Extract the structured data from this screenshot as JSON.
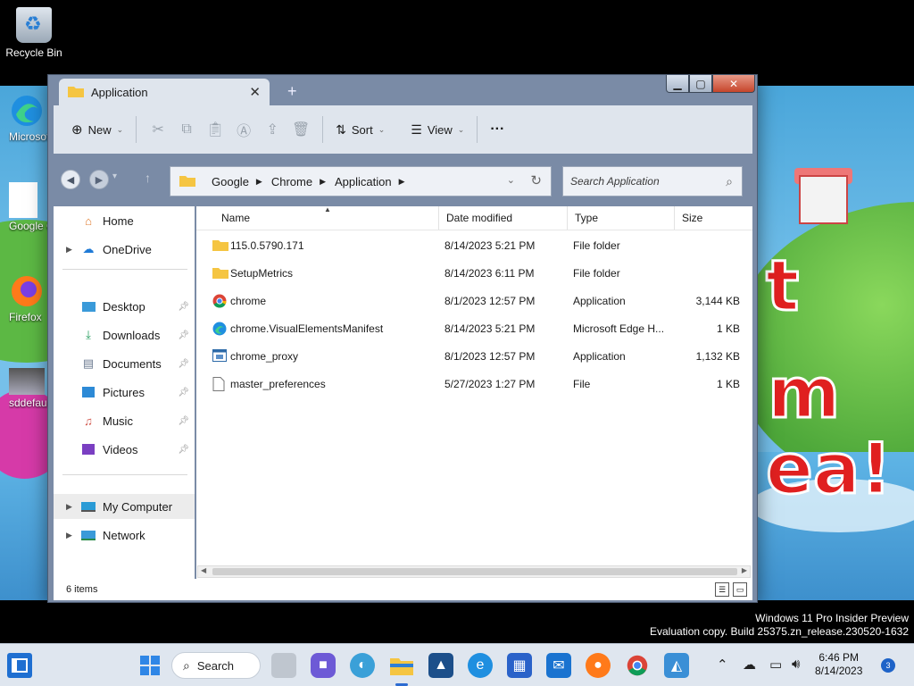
{
  "desktop": {
    "icons": [
      {
        "label": "Recycle Bin"
      },
      {
        "label": "Microsoft Edge"
      },
      {
        "label": "Google Chrome"
      },
      {
        "label": "Firefox"
      },
      {
        "label": "sddefault"
      }
    ],
    "wallpaper_text": [
      "t",
      "m",
      "ea!"
    ]
  },
  "window": {
    "tab_title": "Application",
    "tab_close": "✕",
    "new_tab": "+",
    "caption": {
      "min": "▁",
      "max": "▢",
      "close": "✕"
    },
    "toolbar": {
      "new_label": "New",
      "sort_label": "Sort",
      "view_label": "View",
      "more_label": "···"
    },
    "address": {
      "crumbs": [
        "Google",
        "Chrome",
        "Application"
      ],
      "search_placeholder": "Search Application"
    },
    "nav": {
      "home": "Home",
      "onedrive": "OneDrive",
      "desktop": "Desktop",
      "downloads": "Downloads",
      "documents": "Documents",
      "pictures": "Pictures",
      "music": "Music",
      "videos": "Videos",
      "my_computer": "My Computer",
      "network": "Network"
    },
    "columns": {
      "name": "Name",
      "date": "Date modified",
      "type": "Type",
      "size": "Size"
    },
    "files": [
      {
        "name": "115.0.5790.171",
        "date": "8/14/2023 5:21 PM",
        "type": "File folder",
        "size": "",
        "icon": "folder-icon"
      },
      {
        "name": "SetupMetrics",
        "date": "8/14/2023 6:11 PM",
        "type": "File folder",
        "size": "",
        "icon": "folder-icon"
      },
      {
        "name": "chrome",
        "date": "8/1/2023 12:57 PM",
        "type": "Application",
        "size": "3,144 KB",
        "icon": "chrome-icon"
      },
      {
        "name": "chrome.VisualElementsManifest",
        "date": "8/14/2023 5:21 PM",
        "type": "Microsoft Edge H...",
        "size": "1 KB",
        "icon": "edge-icon"
      },
      {
        "name": "chrome_proxy",
        "date": "8/1/2023 12:57 PM",
        "type": "Application",
        "size": "1,132 KB",
        "icon": "app-icon"
      },
      {
        "name": "master_preferences",
        "date": "5/27/2023 1:27 PM",
        "type": "File",
        "size": "1 KB",
        "icon": "file-icon"
      }
    ],
    "status": "6 items"
  },
  "watermark": {
    "line1": "Windows 11 Pro Insider Preview",
    "line2": "Evaluation copy. Build 25375.zn_release.230520-1632"
  },
  "taskbar": {
    "search_label": "Search",
    "time": "6:46 PM",
    "date": "8/14/2023",
    "notifications": "3"
  },
  "colors": {
    "accent": "#2b6bd1",
    "folder": "#f5c542",
    "window_frame": "#7a8ba6"
  }
}
